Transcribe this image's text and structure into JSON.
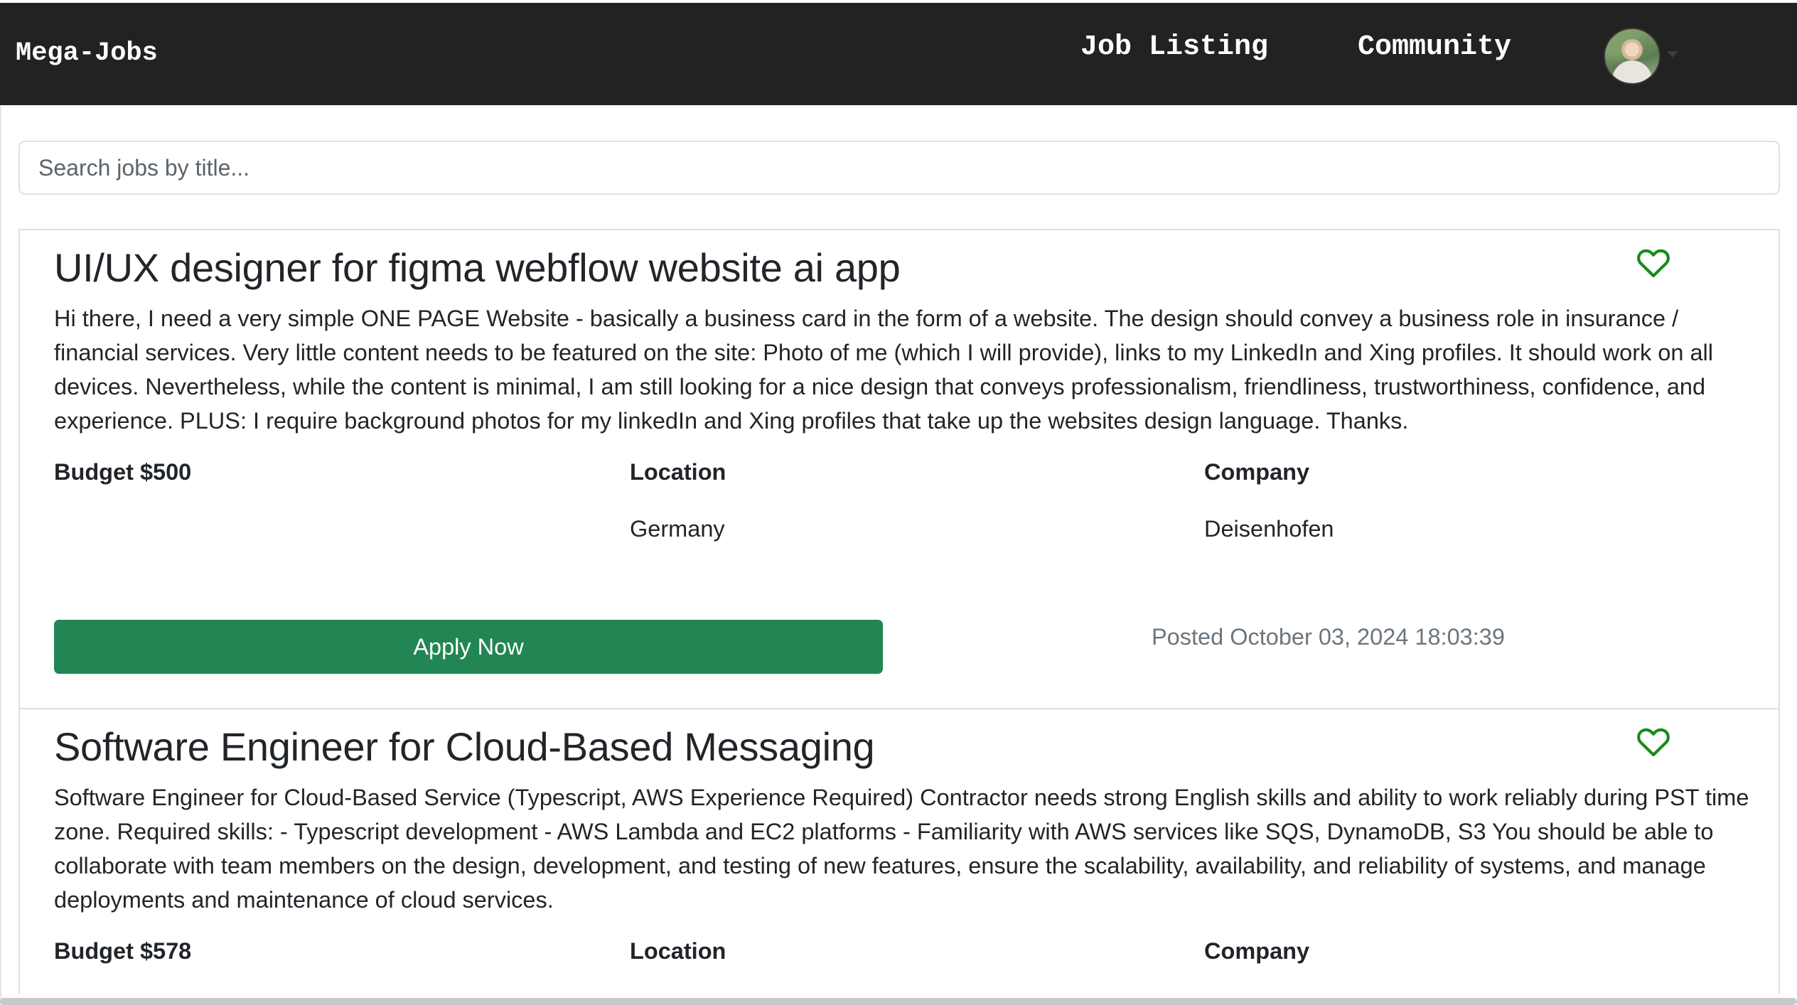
{
  "header": {
    "brand": "Mega-Jobs",
    "nav": {
      "job_listing": "Job Listing",
      "community": "Community"
    },
    "avatar_icon": "user-avatar",
    "dropdown_icon": "caret-down-icon"
  },
  "search": {
    "placeholder": "Search jobs by title...",
    "value": ""
  },
  "colors": {
    "navbar": "#222222",
    "apply_button": "#218653",
    "heart": "#1a8a1a"
  },
  "jobs": [
    {
      "title": "UI/UX designer for figma webflow website ai app",
      "description": "Hi there, I need a very simple ONE PAGE Website - basically a business card in the form of a website. The design should convey a business role in insurance / financial services. Very little content needs to be featured on the site: Photo of me (which I will provide), links to my LinkedIn and Xing profiles. It should work on all devices. Nevertheless, while the content is minimal, I am still looking for a nice design that conveys professionalism, friendliness, trustworthiness, confidence, and experience. PLUS: I require background photos for my linkedIn and Xing profiles that take up the websites design language. Thanks.",
      "budget": "Budget $500",
      "location_label": "Location",
      "location": "Germany",
      "company_label": "Company",
      "company": "Deisenhofen",
      "apply_label": "Apply Now",
      "posted": "Posted October 03, 2024 18:03:39",
      "favorite_icon": "heart-outline-icon"
    },
    {
      "title": "Software Engineer for Cloud-Based Messaging",
      "description": "Software Engineer for Cloud-Based Service (Typescript, AWS Experience Required) Contractor needs strong English skills and ability to work reliably during PST time zone. Required skills: - Typescript development - AWS Lambda and EC2 platforms - Familiarity with AWS services like SQS, DynamoDB, S3 You should be able to collaborate with team members on the design, development, and testing of new features, ensure the scalability, availability, and reliability of systems, and manage deployments and maintenance of cloud services.",
      "budget": "Budget $578",
      "location_label": "Location",
      "company_label": "Company",
      "favorite_icon": "heart-outline-icon"
    }
  ]
}
